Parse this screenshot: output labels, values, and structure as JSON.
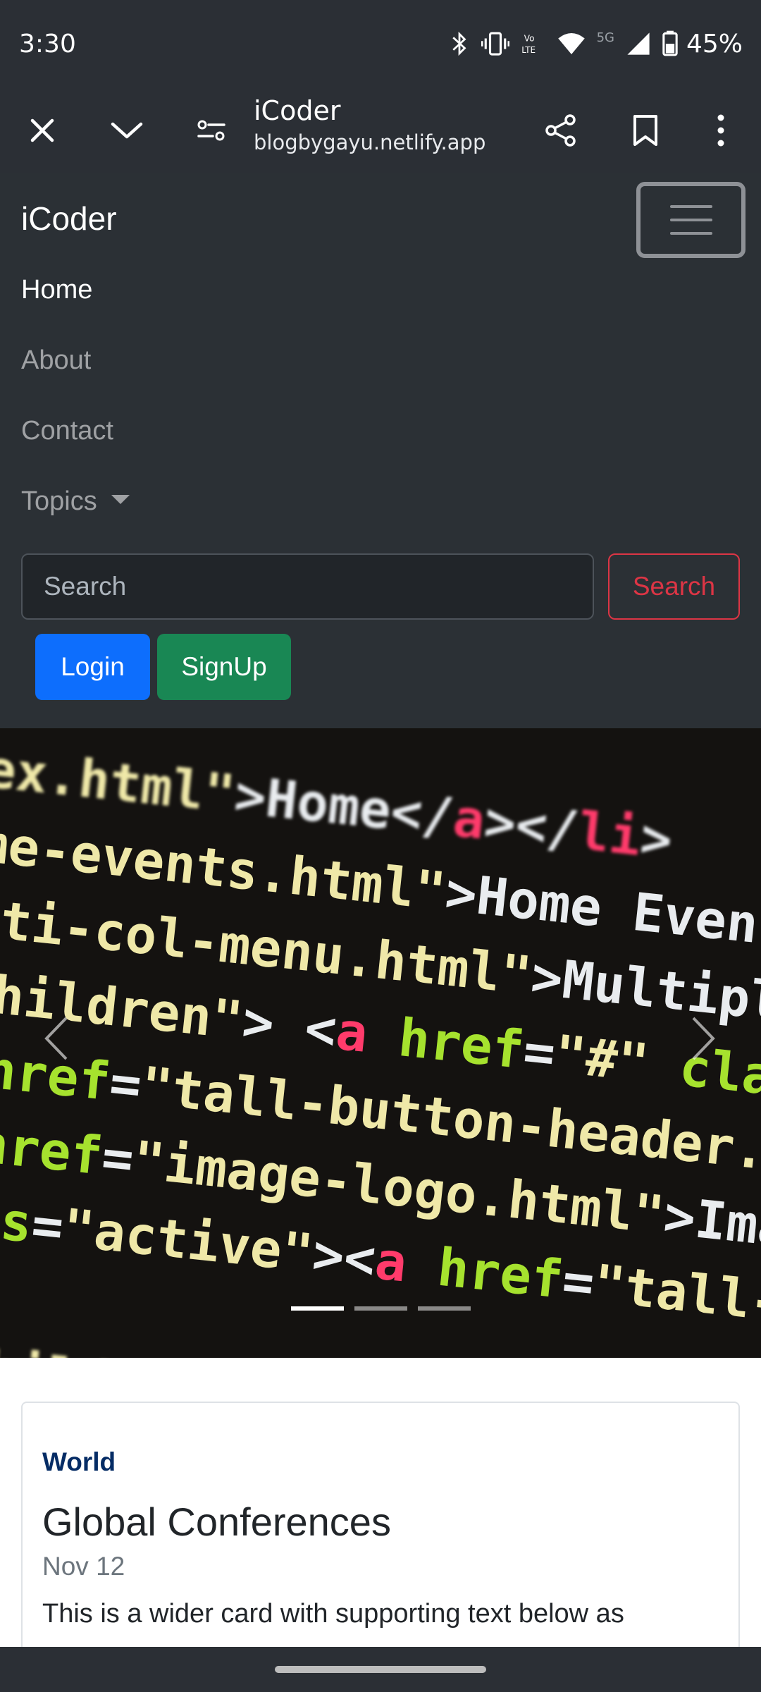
{
  "status_bar": {
    "time": "3:30",
    "network_label": "5G",
    "battery": "45%",
    "icons": [
      "bluetooth-icon",
      "vibrate-icon",
      "volte-icon",
      "wifi-icon",
      "signal-icon",
      "battery-icon"
    ]
  },
  "browser": {
    "title": "iCoder",
    "url": "blogbygayu.netlify.app",
    "icons": [
      "close-icon",
      "chevron-down-icon",
      "site-settings-icon",
      "share-icon",
      "bookmark-icon",
      "more-vert-icon"
    ]
  },
  "navbar": {
    "brand": "iCoder",
    "links": [
      {
        "label": "Home",
        "active": true
      },
      {
        "label": "About",
        "active": false
      },
      {
        "label": "Contact",
        "active": false
      }
    ],
    "dropdown_label": "Topics",
    "search_placeholder": "Search",
    "search_button": "Search",
    "login_button": "Login",
    "signup_button": "SignUp"
  },
  "carousel": {
    "code_lines": [
      {
        "parts": [
          [
            "y",
            "dex.html\""
          ],
          [
            "w",
            ">Home</"
          ],
          [
            "r",
            "a"
          ],
          [
            "w",
            "></"
          ],
          [
            "r",
            "li"
          ],
          [
            "w",
            ">"
          ]
        ]
      },
      {
        "parts": [
          [
            "y",
            "ome-events.html\""
          ],
          [
            "w",
            ">Home Events</"
          ]
        ]
      },
      {
        "parts": [
          [
            "y",
            "ulti-col-menu.html\""
          ],
          [
            "w",
            ">Multiple C"
          ]
        ]
      },
      {
        "parts": [
          [
            "y",
            "-children\""
          ],
          [
            "w",
            "> <"
          ],
          [
            "r",
            "a"
          ],
          [
            "g",
            " href"
          ],
          [
            "w",
            "="
          ],
          [
            "y",
            "\"#\""
          ],
          [
            "g",
            " class"
          ]
        ]
      },
      {
        "parts": [
          [
            "g",
            "  href"
          ],
          [
            "w",
            "="
          ],
          [
            "y",
            "\"tall-button-header.ht"
          ]
        ]
      },
      {
        "parts": [
          [
            "r",
            "a"
          ],
          [
            "g",
            " href"
          ],
          [
            "w",
            "="
          ],
          [
            "y",
            "\"image-logo.html\""
          ],
          [
            "w",
            ">Image"
          ]
        ]
      },
      {
        "parts": [
          [
            "g",
            "lass"
          ],
          [
            "w",
            "="
          ],
          [
            "y",
            "\"active\""
          ],
          [
            "w",
            "><"
          ],
          [
            "r",
            "a"
          ],
          [
            "g",
            " href"
          ],
          [
            "w",
            "="
          ],
          [
            "y",
            "\"tall-"
          ]
        ]
      },
      {
        "parts": [
          [
            "w",
            " "
          ]
        ]
      },
      {
        "parts": [
          [
            "y",
            "s-children\""
          ],
          [
            "w",
            "> <"
          ],
          [
            "r",
            "a"
          ],
          [
            "g",
            " hr"
          ]
        ]
      }
    ],
    "slide_count": 3,
    "active_slide": 1
  },
  "card": {
    "category": "World",
    "title": "Global Conferences",
    "date": "Nov 12",
    "text": "This is a wider card with supporting text below as"
  },
  "colors": {
    "navbar_bg": "#2b3035",
    "primary": "#0d6efd",
    "success": "#198754",
    "danger": "#dc3545",
    "category": "#052c65"
  }
}
